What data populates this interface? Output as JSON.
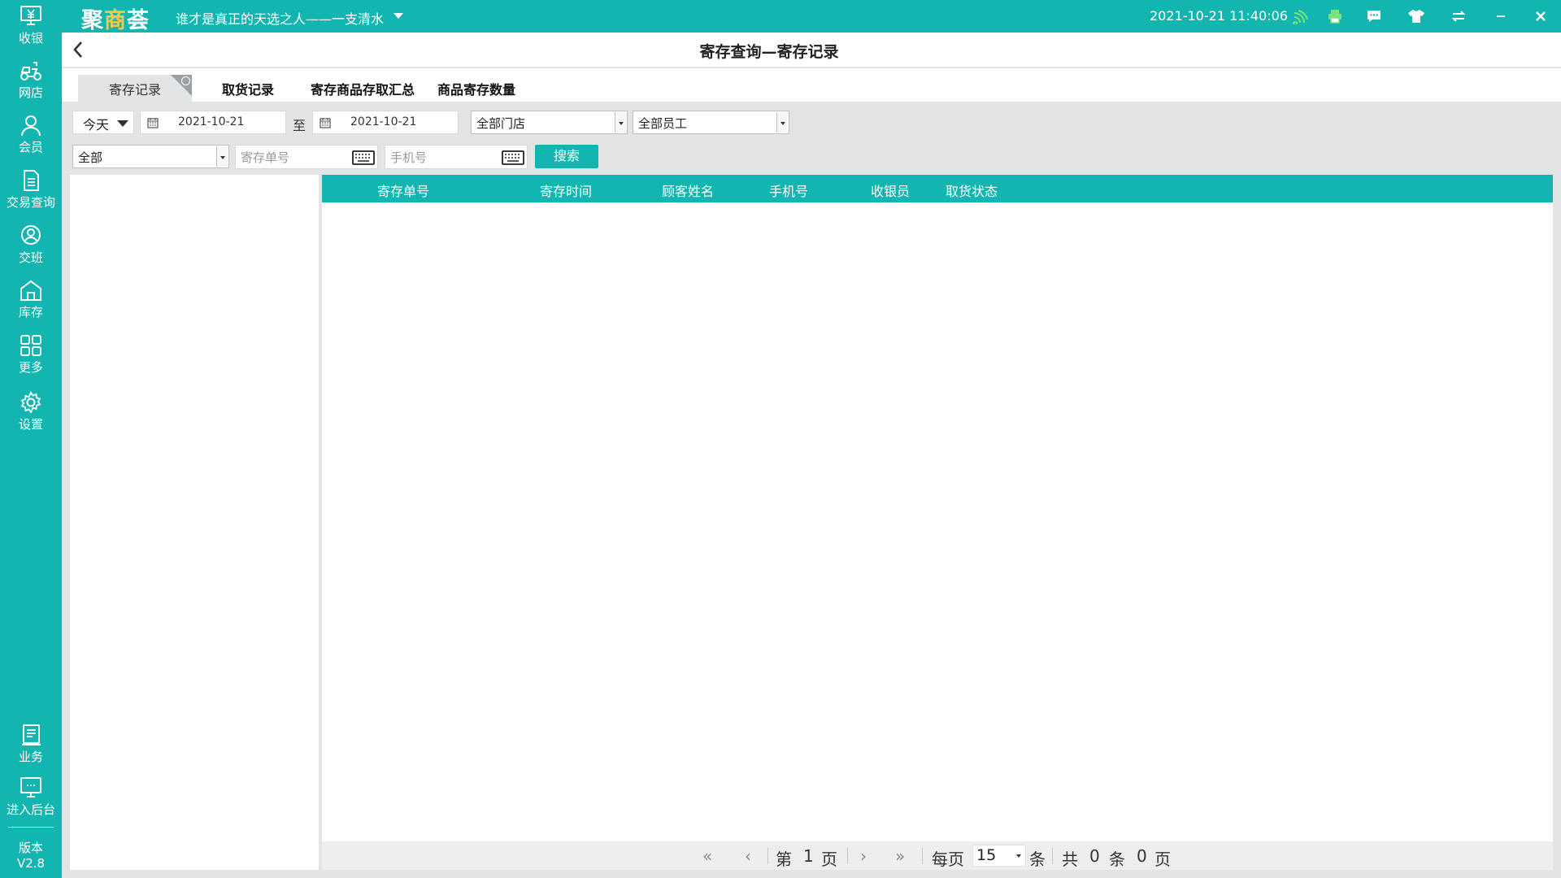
{
  "app": {
    "logo": "聚商荟",
    "logo_parts": [
      "聚",
      "商",
      "荟"
    ],
    "store_name": "谁才是真正的天选之人——一支清水",
    "datetime": "2021-10-21 11:40:06"
  },
  "sidebar": {
    "items": [
      {
        "label": "收银",
        "icon": "cashier-icon"
      },
      {
        "label": "网店",
        "icon": "delivery-icon"
      },
      {
        "label": "会员",
        "icon": "member-icon"
      },
      {
        "label": "交易查询",
        "icon": "document-icon"
      },
      {
        "label": "交班",
        "icon": "shift-icon"
      },
      {
        "label": "库存",
        "icon": "warehouse-icon"
      },
      {
        "label": "更多",
        "icon": "grid-icon"
      },
      {
        "label": "设置",
        "icon": "gear-icon"
      }
    ],
    "bottom_items": [
      {
        "label": "业务",
        "icon": "business-icon"
      },
      {
        "label": "进入后台",
        "icon": "monitor-icon"
      }
    ],
    "version_label": "版本",
    "version_value": "V2.8"
  },
  "header": {
    "title": "寄存查询—寄存记录"
  },
  "tabs": [
    {
      "label": "寄存记录",
      "active": true
    },
    {
      "label": "取货记录",
      "active": false
    },
    {
      "label": "寄存商品存取汇总",
      "active": false
    },
    {
      "label": "商品寄存数量",
      "active": false
    }
  ],
  "filters": {
    "period": "今天",
    "start_date": "2021-10-21",
    "to_label": "至",
    "end_date": "2021-10-21",
    "store": "全部门店",
    "employee": "全部员工",
    "status": "全部",
    "order_no_placeholder": "寄存单号",
    "phone_placeholder": "手机号",
    "search_label": "搜索"
  },
  "table": {
    "columns": [
      "寄存单号",
      "寄存时间",
      "顾客姓名",
      "手机号",
      "收银员",
      "取货状态"
    ],
    "rows": []
  },
  "pager": {
    "first": "«",
    "prev": "‹",
    "page_prefix": "第",
    "page": "1",
    "page_suffix": "页",
    "next": "›",
    "last": "»",
    "per_page_prefix": "每页",
    "per_page": "15",
    "per_page_suffix": "条",
    "total_prefix": "共",
    "total_count": "0",
    "total_unit": "条",
    "total_pages": "0",
    "total_pages_unit": "页"
  },
  "colors": {
    "accent": "#13b5b1",
    "logo_highlight": "#f2c94c",
    "background": "#e3e4e6"
  }
}
